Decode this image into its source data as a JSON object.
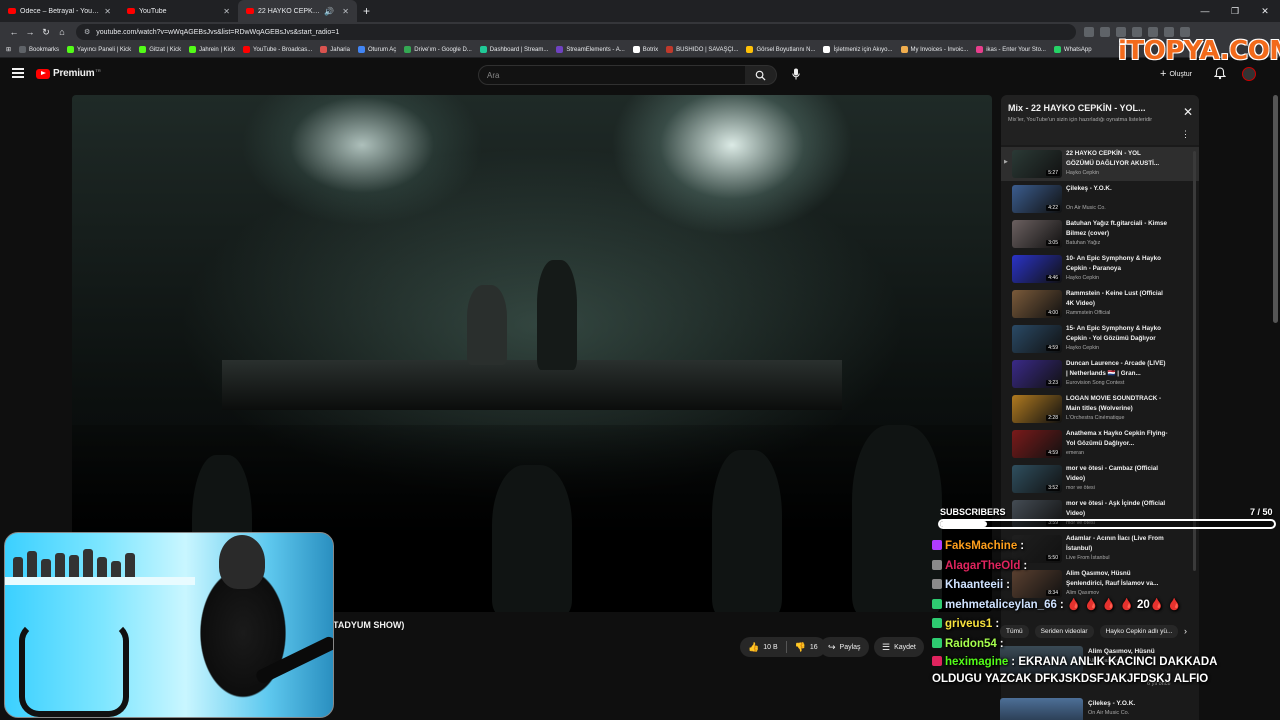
{
  "browser": {
    "tabs": [
      {
        "label": "Odece – Betrayal - YouTube",
        "active": false
      },
      {
        "label": "YouTube",
        "active": false
      },
      {
        "label": "22 HAYKO CEPKİN - YOL GÖ",
        "active": true
      }
    ],
    "new_tab": "+",
    "url": "youtube.com/watch?v=wWqAGEBsJvs&list=RDwWqAGEBsJvs&start_radio=1",
    "bookmarks": [
      {
        "label": "Bookmarks",
        "color": "#5f6368"
      },
      {
        "label": "Yayıncı Paneli | Kick",
        "color": "#53fc18"
      },
      {
        "label": "Gitzat | Kick",
        "color": "#53fc18"
      },
      {
        "label": "Jahrein | Kick",
        "color": "#53fc18"
      },
      {
        "label": "YouTube - Broadcas...",
        "color": "#ff0000"
      },
      {
        "label": "Jaharia",
        "color": "#d9534f"
      },
      {
        "label": "Oturum Aç",
        "color": "#4285f4"
      },
      {
        "label": "Drive'ım - Google D...",
        "color": "#34a853"
      },
      {
        "label": "Dashboard | Stream...",
        "color": "#20c997"
      },
      {
        "label": "StreamElements - A...",
        "color": "#6f42c1"
      },
      {
        "label": "Botrix",
        "color": "#ffffff"
      },
      {
        "label": "BUSHIDO | SAVAŞÇI...",
        "color": "#c0392b"
      },
      {
        "label": "Görsel Boyutlarını N...",
        "color": "#ffc107"
      },
      {
        "label": "İşletmeniz için Akıyo...",
        "color": "#ffffff"
      },
      {
        "label": "My Invoices - Invoic...",
        "color": "#f0ad4e"
      },
      {
        "label": "ikas - Enter Your Sto...",
        "color": "#e83e8c"
      },
      {
        "label": "WhatsApp",
        "color": "#25d366"
      }
    ]
  },
  "youtube": {
    "logo_text": "Premium",
    "logo_sup": "TR",
    "search_placeholder": "Ara",
    "create_label": "Oluştur"
  },
  "watermark": "iTOPYA.COM",
  "video": {
    "title_fragment": "TADYUM SHOW)",
    "likes": "10 B",
    "dislikes": "16",
    "share_label": "Paylaş",
    "save_label": "Kaydet"
  },
  "playlist": {
    "title": "Mix - 22 HAYKO CEPKİN - YOL...",
    "subtitle": "Mix'ler, YouTube'un sizin için hazırladığı oynatma listeleridir",
    "items": [
      {
        "title": "22 HAYKO CEPKİN - YOL GÖZÜMÜ DAĞLIYOR AKUSTİ...",
        "channel": "Hayko Cepkin",
        "duration": "5:27",
        "current": true,
        "thumb": "#2b3a36"
      },
      {
        "title": "Çilekeş - Y.O.K.",
        "channel": "On Air Music Co.",
        "duration": "4:22",
        "current": false,
        "thumb": "#3b5d8f"
      },
      {
        "title": "Batuhan Yağız ft.gitarciali - Kimse Bilmez (cover)",
        "channel": "Batuhan Yağız",
        "duration": "3:05",
        "current": false,
        "thumb": "#6b6060"
      },
      {
        "title": "10- An Epic Symphony & Hayko Cepkin - Paranoya",
        "channel": "Hayko Cepkin",
        "duration": "4:46",
        "current": false,
        "thumb": "#2a33c8"
      },
      {
        "title": "Rammstein - Keine Lust (Official 4K Video)",
        "channel": "Rammstein Official",
        "duration": "4:00",
        "current": false,
        "thumb": "#7a5a3a"
      },
      {
        "title": "15- An Epic Symphony & Hayko Cepkin - Yol Gözümü Dağlıyor",
        "channel": "Hayko Cepkin",
        "duration": "4:59",
        "current": false,
        "thumb": "#2a4a66"
      },
      {
        "title": "Duncan Laurence - Arcade (LIVE) | Netherlands 🇳🇱 | Gran...",
        "channel": "Eurovision Song Contest",
        "duration": "3:23",
        "current": false,
        "thumb": "#3a2a88"
      },
      {
        "title": "LOGAN MOVIE SOUNDTRACK - Main titles (Wolverine)",
        "channel": "L'Orchestra Cinématique",
        "duration": "2:28",
        "current": false,
        "thumb": "#b07a20"
      },
      {
        "title": "Anathema x Hayko Cepkin Flying-Yol Gözümü Dağlıyor...",
        "channel": "emeran",
        "duration": "4:59",
        "current": false,
        "thumb": "#7a1a1a"
      },
      {
        "title": "mor ve ötesi - Cambaz (Official Video)",
        "channel": "mor ve ötesi",
        "duration": "3:52",
        "current": false,
        "thumb": "#2f4f5f"
      },
      {
        "title": "mor ve ötesi - Aşk İçinde (Official Video)",
        "channel": "mor ve ötesi",
        "duration": "3:59",
        "current": false,
        "thumb": "#444c54"
      },
      {
        "title": "Adamlar - Acının İlacı (Live From İstanbul)",
        "channel": "Live From İstanbul",
        "duration": "5:50",
        "current": false,
        "thumb": "#1f1f1f"
      },
      {
        "title": "Alim Qasımov, Hüsnü Şenlendirici, Rauf İslamov va...",
        "channel": "Alim Qasımov",
        "duration": "8:34",
        "current": false,
        "thumb": "#5a4030"
      }
    ]
  },
  "chips": [
    "Tümü",
    "Seriden videolar",
    "Hayko Cepkin adlı yü..."
  ],
  "recommendations": [
    {
      "title": "Alim Qasımov, Hüsnü",
      "channel": "Alim Qasımov"
    },
    {
      "title": "Çilekeş - Y.O.K.",
      "channel": "On Air Music Co."
    }
  ],
  "rec_meta": "6 yıl önce",
  "stream_overlay": {
    "subs_label": "SUBSCRIBERS",
    "subs_current": "7",
    "subs_goal": "50",
    "subs_count_text": "7 / 50",
    "subs_fraction": 0.14,
    "chat": [
      {
        "user": "FaksMachine",
        "color": "#ff9f1c",
        "badge": "#b03cff",
        "text": ""
      },
      {
        "user": "AlagarTheOld",
        "color": "#e0245e",
        "badge": "#8a8a8a",
        "text": ""
      },
      {
        "user": "Khaanteeii",
        "color": "#cfe2ff",
        "badge": "#8a8a8a",
        "text": ""
      },
      {
        "user": "mehmetaliceylan_66",
        "color": "#cfe2ff",
        "badge": "#2ecc71",
        "text": "🩸 🩸 🩸 🩸 20🩸 🩸"
      },
      {
        "user": "griveus1",
        "color": "#f7e23e",
        "badge": "#2ecc71",
        "text": ""
      },
      {
        "user": "Raidon54",
        "color": "#a6ff4d",
        "badge": "#2ecc71",
        "text": ""
      },
      {
        "user": "heximagine",
        "color": "#53fc18",
        "badge": "#e0245e",
        "text": "EKRANA ANLIK KACINCI DAKKADA OLDUGU YAZCAK DFKJSKDSFJAKJFDSKJ ALFIO"
      }
    ]
  },
  "colors": {
    "youtube_red": "#ff0000",
    "background": "#0f0f0f",
    "watermark_orange": "#f26a1b"
  }
}
